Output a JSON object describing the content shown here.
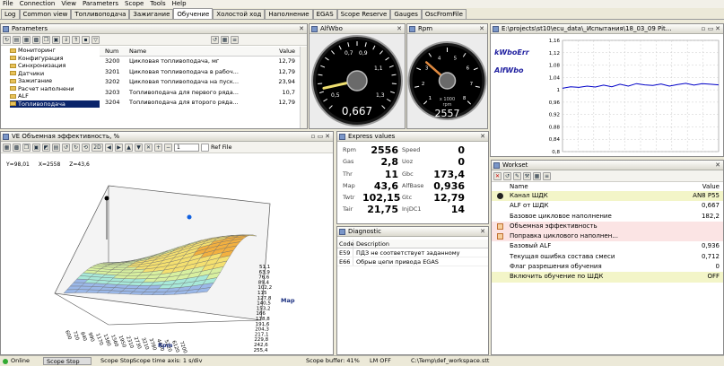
{
  "menu": [
    "File",
    "Connection",
    "View",
    "Parameters",
    "Scope",
    "Tools",
    "Help"
  ],
  "tabs": [
    "Log",
    "Common view",
    "Топливоподача",
    "Зажигание",
    "Обучение",
    "Холостой ход",
    "Наполнение",
    "EGAS",
    "Scope Reserve",
    "Gauges",
    "OscFromFile"
  ],
  "active_tab": 4,
  "parameters": {
    "title": "Parameters",
    "tree": [
      "Мониторинг",
      "Конфигурация",
      "Синхронизация",
      "Датчики",
      "Зажигание",
      "Расчет наполнени",
      "ALF",
      "Топливоподача"
    ],
    "columns": [
      "Num",
      "Name",
      "Value"
    ],
    "rows": [
      {
        "num": "3200",
        "name": "Цикловая топливоподача, мг",
        "value": "12,79"
      },
      {
        "num": "3201",
        "name": "Цикловая топливоподача в рабоч...",
        "value": "12,79"
      },
      {
        "num": "3202",
        "name": "Цикловая топливоподача на пуск...",
        "value": "23,94"
      },
      {
        "num": "3203",
        "name": "Топливоподача для первого ряда...",
        "value": "10,7"
      },
      {
        "num": "3204",
        "name": "Топливоподача для второго ряда...",
        "value": "12,79"
      }
    ]
  },
  "afwbo": {
    "title": "AlfWbo",
    "value": "0,667",
    "ticks": [
      "0,7",
      "0,9",
      "1,1",
      "1,3",
      "0,5"
    ],
    "fraction": 0.12
  },
  "rpm": {
    "title": "Rpm",
    "value": "2557",
    "unit1": "x 1000",
    "unit2": "rpm",
    "ticks": [
      "1",
      "2",
      "3",
      "4",
      "5",
      "6",
      "7",
      "8"
    ],
    "fraction": 0.32
  },
  "scope": {
    "title": "E:\\projects\\st10\\ecu_data\\_Испытания\\18_03_09 Pit...",
    "series": [
      "kWboErr",
      "AlfWbo"
    ],
    "yticks": [
      "1,16",
      "1,12",
      "1,08",
      "1,04",
      "1",
      "0,96",
      "0,92",
      "0,88",
      "0,84",
      "0,8"
    ],
    "values": [
      1.005,
      1.01,
      1.008,
      1.012,
      1.009,
      1.015,
      1.01,
      1.018,
      1.012,
      1.02,
      1.016,
      1.014,
      1.019,
      1.012,
      1.017,
      1.021,
      1.015,
      1.02,
      1.018,
      1.016
    ]
  },
  "ve": {
    "title": "VE  Объемная эффективность, %",
    "coords": {
      "y": "Y=98,01",
      "x": "X=2558",
      "z": "Z=43,6"
    },
    "mode": "2D",
    "combo": "1",
    "ref_label": "Ref File",
    "x_axis_label": "Rpm",
    "y_axis_label": "Map",
    "rpm_ticks": [
      "600",
      "720",
      "840",
      "990",
      "1170",
      "1380",
      "1560",
      "1950",
      "2310",
      "2730",
      "3210",
      "3780",
      "4440",
      "5220",
      "6120",
      "7200"
    ],
    "map_ticks": [
      "51,1",
      "63,9",
      "76,6",
      "89,4",
      "102,2",
      "115",
      "127,8",
      "140,5",
      "153,2",
      "166",
      "178,8",
      "191,6",
      "204,3",
      "217,1",
      "229,8",
      "242,6",
      "255,4"
    ]
  },
  "express": {
    "title": "Express values",
    "rows": [
      {
        "l1": "Rpm",
        "v1": "2556",
        "l2": "Speed",
        "v2": "0"
      },
      {
        "l1": "Gas",
        "v1": "2,8",
        "l2": "Uoz",
        "v2": "0"
      },
      {
        "l1": "Thr",
        "v1": "11",
        "l2": "Gbc",
        "v2": "173,4"
      },
      {
        "l1": "Map",
        "v1": "43,6",
        "l2": "AlfBase",
        "v2": "0,936"
      },
      {
        "l1": "Twtr",
        "v1": "102,15",
        "l2": "Gtc",
        "v2": "12,79"
      },
      {
        "l1": "Tair",
        "v1": "21,75",
        "l2": "InjDC1",
        "v2": "14"
      }
    ]
  },
  "diagnostic": {
    "title": "Diagnostic",
    "columns": [
      "Code",
      "Description"
    ],
    "rows": [
      {
        "code": "E59",
        "desc": "ПДЗ не соответствует заданному"
      },
      {
        "code": "E66",
        "desc": "Обрыв цепи привода EGAS"
      }
    ]
  },
  "workset": {
    "title": "Workset",
    "columns": [
      "Name",
      "Value"
    ],
    "rows": [
      {
        "name": "Канал ШДК",
        "value": "AN8  P55",
        "style": "y",
        "icon": "key"
      },
      {
        "name": "ALF от ШДК",
        "value": "0,667",
        "style": "",
        "icon": ""
      },
      {
        "name": "Базовое цикловое наполнение",
        "value": "182,2",
        "style": "",
        "icon": ""
      },
      {
        "name": "Объемная эффективность",
        "value": "",
        "style": "p",
        "icon": "grid"
      },
      {
        "name": "Поправка циклового наполнен...",
        "value": "",
        "style": "p",
        "icon": "grid"
      },
      {
        "name": "Базовый ALF",
        "value": "0,936",
        "style": "",
        "icon": ""
      },
      {
        "name": "Текущая ошибка состава смеси",
        "value": "0,712",
        "style": "",
        "icon": ""
      },
      {
        "name": "Флаг разрешения обучения",
        "value": "0",
        "style": "",
        "icon": ""
      },
      {
        "name": "Включить обучение по ШДК",
        "value": "OFF",
        "style": "y",
        "icon": ""
      }
    ]
  },
  "status": {
    "online": "Online",
    "scope_stop_btn": "Scope Stop",
    "scope_stop": "Scope Stop",
    "time_axis": "Scope time axis: 1 s/div",
    "buffer": "Scope buffer: 41%",
    "lm": "LM OFF",
    "file": "C:\\Temp\\def_workspace.stt"
  },
  "colors": {
    "accent": "#0a246a",
    "gauge_needle_afwbo": "#f0e070",
    "gauge_needle_rpm": "#e08a40",
    "plot_line": "#0000c8"
  }
}
